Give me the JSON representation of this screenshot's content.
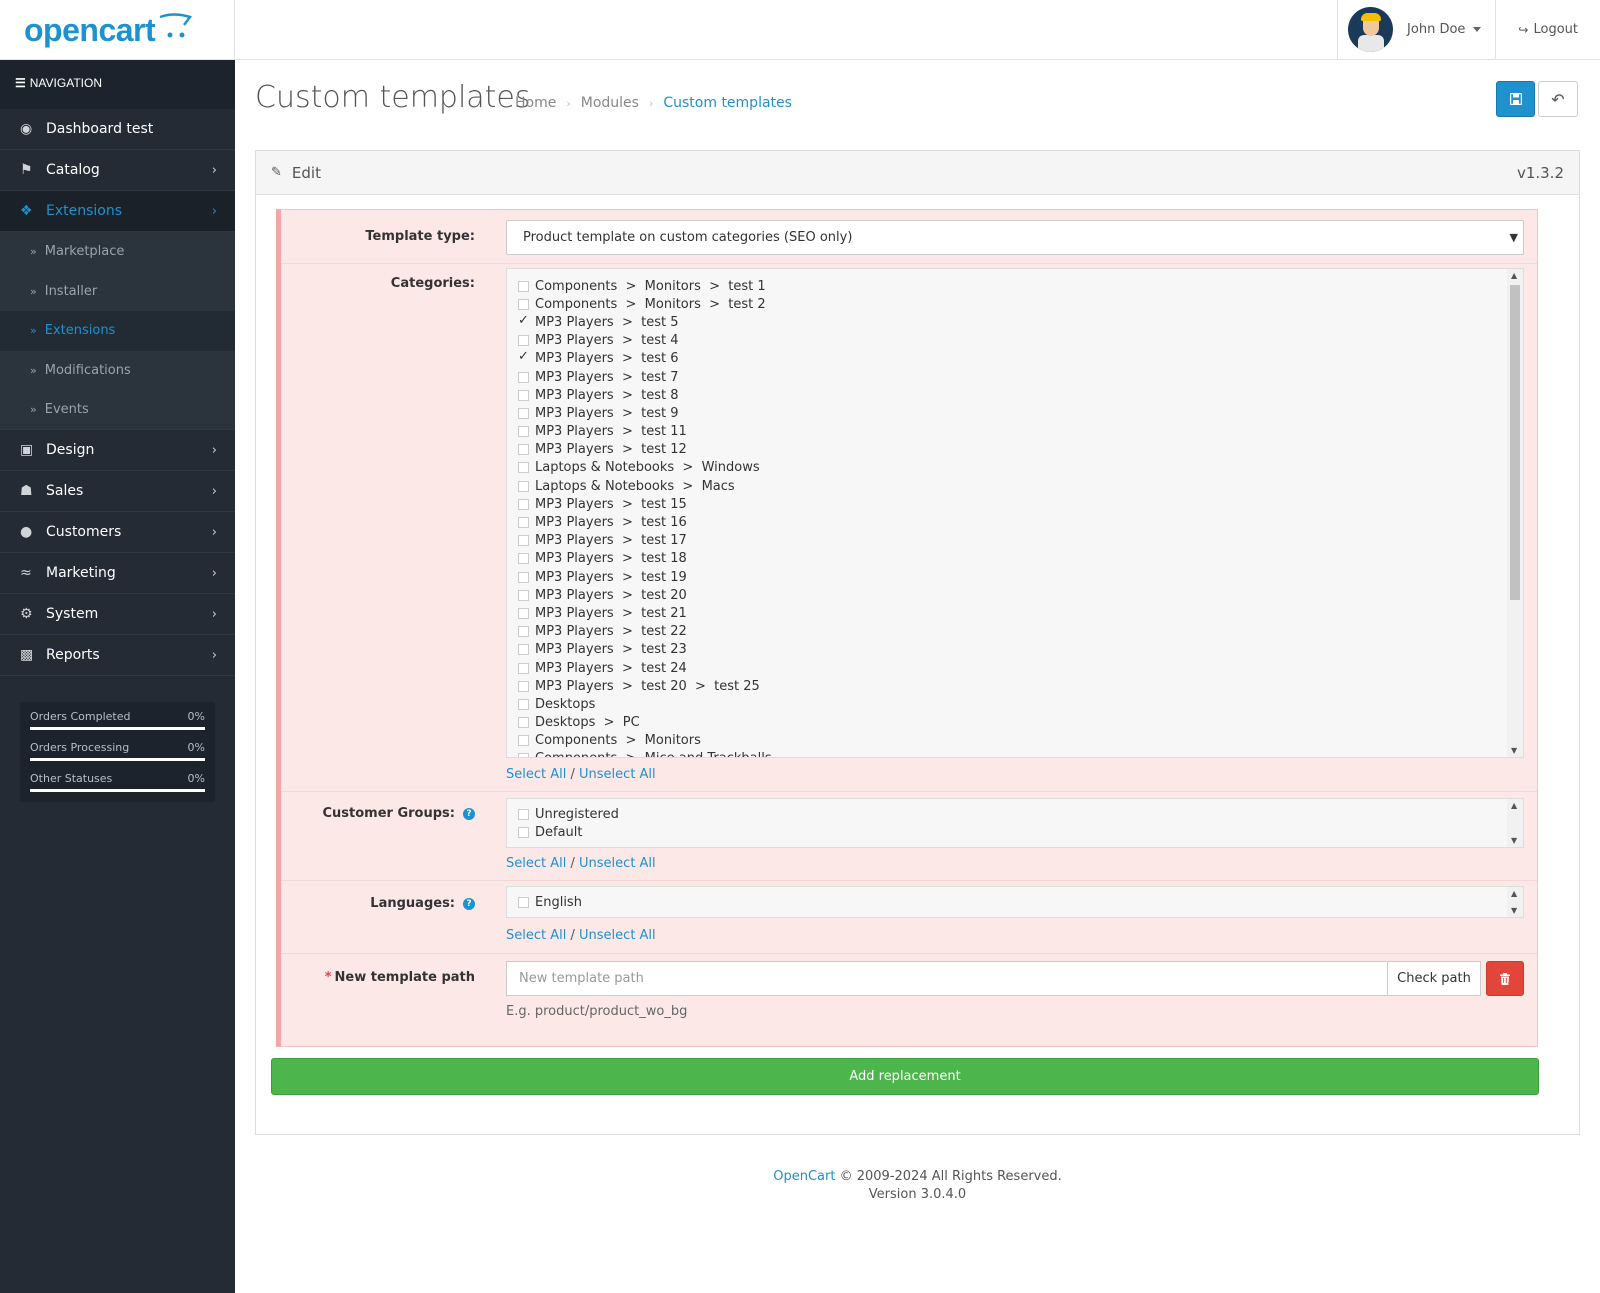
{
  "header": {
    "logo_text": "opencart",
    "user_name": "John Doe",
    "logout_label": "Logout"
  },
  "sidebar": {
    "heading": "NAVIGATION",
    "items": [
      {
        "label": "Dashboard test",
        "icon": "dashboard-icon"
      },
      {
        "label": "Catalog",
        "icon": "tags-icon"
      },
      {
        "label": "Extensions",
        "icon": "puzzle-icon"
      },
      {
        "label": "Design",
        "icon": "desktop-icon"
      },
      {
        "label": "Sales",
        "icon": "cart-icon"
      },
      {
        "label": "Customers",
        "icon": "user-icon"
      },
      {
        "label": "Marketing",
        "icon": "share-icon"
      },
      {
        "label": "System",
        "icon": "gear-icon"
      },
      {
        "label": "Reports",
        "icon": "bar-chart-icon"
      }
    ],
    "extensions_sub": [
      "Marketplace",
      "Installer",
      "Extensions",
      "Modifications",
      "Events"
    ],
    "stats": [
      {
        "label": "Orders Completed",
        "value": "0%"
      },
      {
        "label": "Orders Processing",
        "value": "0%"
      },
      {
        "label": "Other Statuses",
        "value": "0%"
      }
    ]
  },
  "page": {
    "title": "Custom templates",
    "breadcrumb": [
      "Home",
      "Modules",
      "Custom templates"
    ]
  },
  "panel": {
    "heading": "Edit",
    "version": "v1.3.2"
  },
  "form": {
    "template_type_label": "Template type:",
    "template_type_value": "Product template on custom categories (SEO only)",
    "categories_label": "Categories:",
    "categories": [
      {
        "label": "Components  >  Monitors  >  test 1",
        "checked": false
      },
      {
        "label": "Components  >  Monitors  >  test 2",
        "checked": false
      },
      {
        "label": "MP3 Players  >  test 5",
        "checked": true
      },
      {
        "label": "MP3 Players  >  test 4",
        "checked": false
      },
      {
        "label": "MP3 Players  >  test 6",
        "checked": true
      },
      {
        "label": "MP3 Players  >  test 7",
        "checked": false
      },
      {
        "label": "MP3 Players  >  test 8",
        "checked": false
      },
      {
        "label": "MP3 Players  >  test 9",
        "checked": false
      },
      {
        "label": "MP3 Players  >  test 11",
        "checked": false
      },
      {
        "label": "MP3 Players  >  test 12",
        "checked": false
      },
      {
        "label": "Laptops & Notebooks  >  Windows",
        "checked": false
      },
      {
        "label": "Laptops & Notebooks  >  Macs",
        "checked": false
      },
      {
        "label": "MP3 Players  >  test 15",
        "checked": false
      },
      {
        "label": "MP3 Players  >  test 16",
        "checked": false
      },
      {
        "label": "MP3 Players  >  test 17",
        "checked": false
      },
      {
        "label": "MP3 Players  >  test 18",
        "checked": false
      },
      {
        "label": "MP3 Players  >  test 19",
        "checked": false
      },
      {
        "label": "MP3 Players  >  test 20",
        "checked": false
      },
      {
        "label": "MP3 Players  >  test 21",
        "checked": false
      },
      {
        "label": "MP3 Players  >  test 22",
        "checked": false
      },
      {
        "label": "MP3 Players  >  test 23",
        "checked": false
      },
      {
        "label": "MP3 Players  >  test 24",
        "checked": false
      },
      {
        "label": "MP3 Players  >  test 20  >  test 25",
        "checked": false
      },
      {
        "label": "Desktops",
        "checked": false
      },
      {
        "label": "Desktops  >  PC",
        "checked": false
      },
      {
        "label": "Components  >  Monitors",
        "checked": false
      },
      {
        "label": "Components  >  Mice and Trackballs",
        "checked": false
      }
    ],
    "customer_groups_label": "Customer Groups:",
    "customer_groups": [
      {
        "label": "Unregistered",
        "checked": false
      },
      {
        "label": "Default",
        "checked": false
      }
    ],
    "languages_label": "Languages:",
    "languages": [
      {
        "label": "English",
        "checked": false
      }
    ],
    "select_all": "Select All",
    "unselect_all": "Unselect All",
    "slash": "/",
    "path_label": "New template path",
    "path_required_mark": "*",
    "path_placeholder": "New template path",
    "check_path": "Check path",
    "path_hint": "E.g. product/product_wo_bg",
    "add_button": "Add replacement"
  },
  "footer": {
    "link": "OpenCart",
    "copyright": " © 2009-2024 All Rights Reserved.",
    "version": "Version 3.0.4.0"
  },
  "colors": {
    "accent": "#1e91cf",
    "sidebar_bg": "#242b35",
    "success": "#4cb64c",
    "danger": "#e2463a",
    "form_bg": "#fde8e8"
  }
}
